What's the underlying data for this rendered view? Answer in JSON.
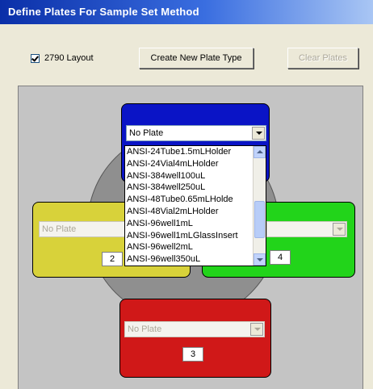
{
  "window": {
    "title": "Define Plates For Sample Set Method"
  },
  "toolbar": {
    "layout_checkbox_label": "2790 Layout",
    "layout_checked": true,
    "create_button_label": "Create New Plate Type",
    "clear_button_label": "Clear Plates"
  },
  "slots": {
    "slot1": {
      "plate": "No Plate",
      "color": "#0a14c6"
    },
    "slot2": {
      "plate": "No Plate",
      "number": "2",
      "color": "#d8d23a"
    },
    "slot3": {
      "plate": "No Plate",
      "number": "3",
      "color": "#d01818"
    },
    "slot4": {
      "plate": "",
      "number": "4",
      "color": "#22d41a"
    }
  },
  "dropdown": {
    "items": [
      "ANSI-24Tube1.5mLHolder",
      "ANSI-24Vial4mLHolder",
      "ANSI-384well100uL",
      "ANSI-384well250uL",
      "ANSI-48Tube0.65mLHolde",
      "ANSI-48Vial2mLHolder",
      "ANSI-96well1mL",
      "ANSI-96well1mLGlassInsert",
      "ANSI-96well2mL",
      "ANSI-96well350uL"
    ]
  }
}
